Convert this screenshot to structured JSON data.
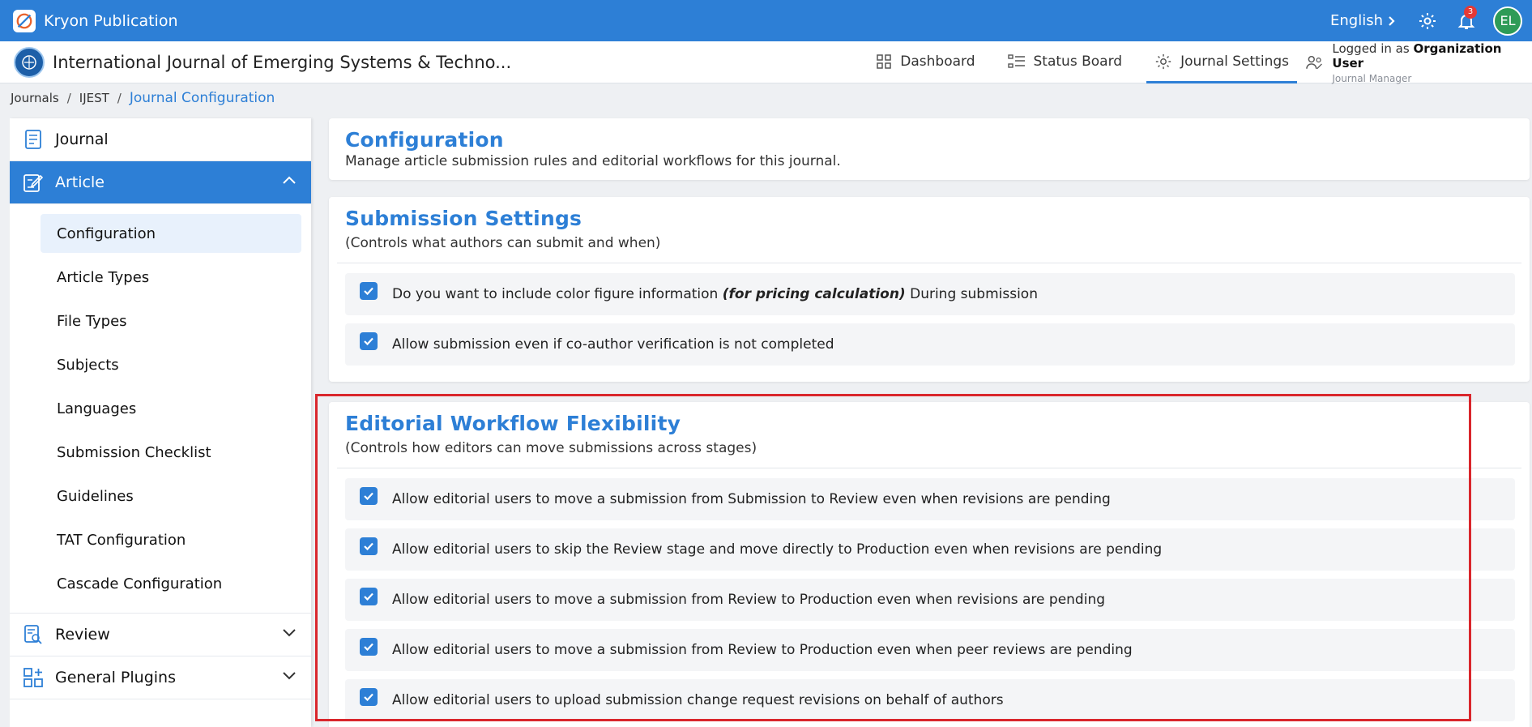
{
  "app": {
    "title": "Kryon Publication",
    "language": "English",
    "notification_count": "3",
    "user_initials": "EL"
  },
  "header": {
    "journal_title": "International Journal of Emerging Systems & Techno...",
    "tabs": [
      {
        "label": "Dashboard",
        "icon": "grid-icon"
      },
      {
        "label": "Status Board",
        "icon": "board-icon"
      },
      {
        "label": "Journal Settings",
        "icon": "gear-icon"
      }
    ],
    "active_tab": "Journal Settings",
    "logged_in_prefix": "Logged in as",
    "logged_in_user": "Organization User",
    "role": "Journal Manager"
  },
  "breadcrumb": [
    "Journals",
    "IJEST",
    "Journal Configuration"
  ],
  "sidebar": {
    "sections": [
      {
        "label": "Journal",
        "icon": "journal-icon"
      },
      {
        "label": "Article",
        "icon": "article-edit-icon"
      },
      {
        "label": "Review",
        "icon": "review-icon"
      },
      {
        "label": "General Plugins",
        "icon": "plugins-icon"
      }
    ],
    "article_items": [
      "Configuration",
      "Article Types",
      "File Types",
      "Subjects",
      "Languages",
      "Submission Checklist",
      "Guidelines",
      "TAT Configuration",
      "Cascade Configuration"
    ]
  },
  "main": {
    "config_title": "Configuration",
    "config_subtitle": "Manage article submission rules and editorial workflows for this journal.",
    "submission": {
      "title": "Submission Settings",
      "subtitle": "(Controls what authors can submit and when)",
      "opt1_pre": "Do you want to include color figure information",
      "opt1_em": "(for pricing calculation)",
      "opt1_post": "During submission",
      "opt2": "Allow submission even if co-author verification is not completed"
    },
    "workflow": {
      "title": "Editorial Workflow Flexibility",
      "subtitle": "(Controls how editors can move submissions across stages)",
      "options": [
        "Allow editorial users to move a submission from Submission to Review even when revisions are pending",
        "Allow editorial users to skip the Review stage and move directly to Production even when revisions are pending",
        "Allow editorial users to move a submission from Review to Production even when revisions are pending",
        "Allow editorial users to move a submission from Review to Production even when peer reviews are pending",
        "Allow editorial users to upload submission change request revisions on behalf of authors"
      ]
    }
  },
  "colors": {
    "primary": "#2d7fd6",
    "highlight_box": "#d9262c",
    "avatar": "#2e9b57"
  }
}
